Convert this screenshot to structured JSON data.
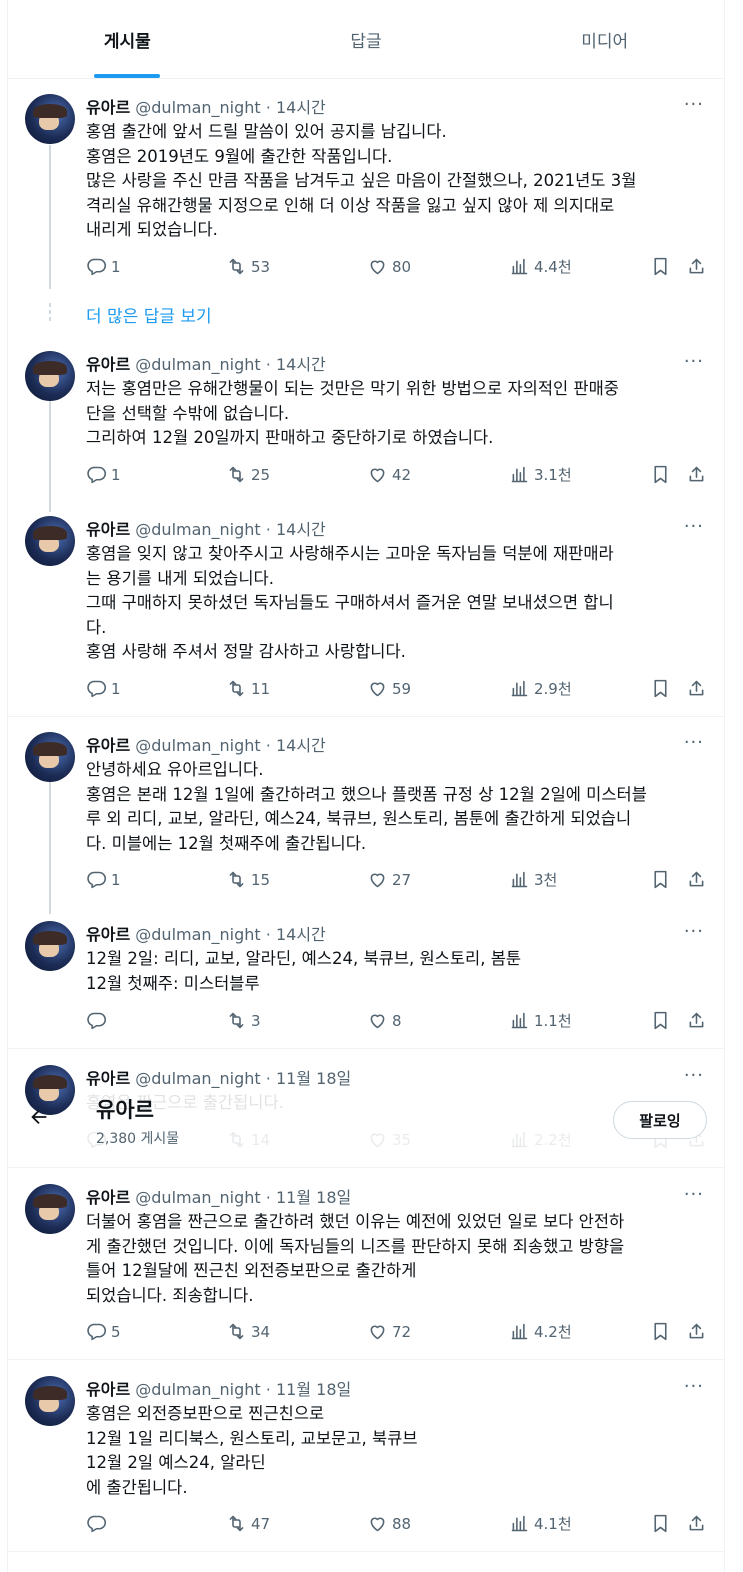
{
  "tabs": [
    {
      "label": "게시물",
      "active": true
    },
    {
      "label": "답글",
      "active": false
    },
    {
      "label": "미디어",
      "active": false
    }
  ],
  "show_more_replies": "더 많은 답글 보기",
  "more_glyph": "···",
  "profile_header": {
    "back_icon": "arrow-left-icon",
    "name": "유아르",
    "post_count": "2,380 게시물",
    "follow_label": "팔로잉"
  },
  "tweets": [
    {
      "name": "유아르",
      "handle": "@dulman_night",
      "time": "14시간",
      "body": "홍염 출간에 앞서 드릴 말씀이 있어 공지를 남깁니다.\n홍염은 2019년도 9월에 출간한 작품입니다.\n많은 사랑을 주신 만큼 작품을 남겨두고 싶은 마음이 간절했으나, 2021년도 3월\n격리실 유해간행물 지정으로 인해 더 이상 작품을 잃고 싶지 않아 제 의지대로\n내리게 되었습니다.",
      "replies": "1",
      "retweets": "53",
      "likes": "80",
      "views": "4.4천"
    },
    {
      "name": "유아르",
      "handle": "@dulman_night",
      "time": "14시간",
      "body": "저는 홍염만은 유해간행물이 되는 것만은 막기 위한 방법으로 자의적인 판매중\n단을 선택할 수밖에 없습니다.\n그리하여 12월 20일까지 판매하고 중단하기로 하였습니다.",
      "replies": "1",
      "retweets": "25",
      "likes": "42",
      "views": "3.1천"
    },
    {
      "name": "유아르",
      "handle": "@dulman_night",
      "time": "14시간",
      "body": "홍염을 잊지 않고 찾아주시고 사랑해주시는 고마운 독자님들 덕분에 재판매라\n는 용기를 내게 되었습니다.\n그때 구매하지 못하셨던 독자님들도 구매하셔서 즐거운 연말 보내셨으면 합니\n다.\n홍염 사랑해 주셔서 정말 감사하고 사랑합니다.",
      "replies": "1",
      "retweets": "11",
      "likes": "59",
      "views": "2.9천"
    },
    {
      "name": "유아르",
      "handle": "@dulman_night",
      "time": "14시간",
      "body": "안녕하세요 유아르입니다.\n홍염은 본래 12월 1일에 출간하려고 했으나 플랫폼 규정 상 12월 2일에 미스터블\n루 외 리디, 교보, 알라딘, 예스24, 북큐브, 원스토리, 봄툰에 출간하게 되었습니\n다. 미블에는 12월 첫째주에 출간됩니다.",
      "replies": "1",
      "retweets": "15",
      "likes": "27",
      "views": "3천"
    },
    {
      "name": "유아르",
      "handle": "@dulman_night",
      "time": "14시간",
      "body": "12월 2일: 리디, 교보, 알라딘, 예스24, 북큐브, 원스토리, 봄툰\n12월 첫째주: 미스터블루",
      "replies": "",
      "retweets": "3",
      "likes": "8",
      "views": "1.1천"
    },
    {
      "name": "유아르",
      "handle": "@dulman_night",
      "time": "11월 18일",
      "body": "홍염은 짠근으로 출간됩니다.",
      "replies": "",
      "retweets": "14",
      "likes": "35",
      "views": "2.2천"
    },
    {
      "name": "유아르",
      "handle": "@dulman_night",
      "time": "11월 18일",
      "body": "더불어 홍염을 짠근으로 출간하려 했던 이유는 예전에 있었던 일로 보다 안전하\n게 출간했던 것입니다. 이에 독자님들의 니즈를 판단하지 못해 죄송했고 방향을\n틀어 12월달에 찐근친 외전증보판으로 출간하게\n되었습니다. 죄송합니다.",
      "replies": "5",
      "retweets": "34",
      "likes": "72",
      "views": "4.2천"
    },
    {
      "name": "유아르",
      "handle": "@dulman_night",
      "time": "11월 18일",
      "body": "홍염은 외전증보판으로 찐근친으로\n12월 1일 리디북스, 원스토리, 교보문고, 북큐브\n12월 2일 예스24, 알라딘\n에 출간됩니다.",
      "replies": "",
      "retweets": "47",
      "likes": "88",
      "views": "4.1천"
    }
  ]
}
